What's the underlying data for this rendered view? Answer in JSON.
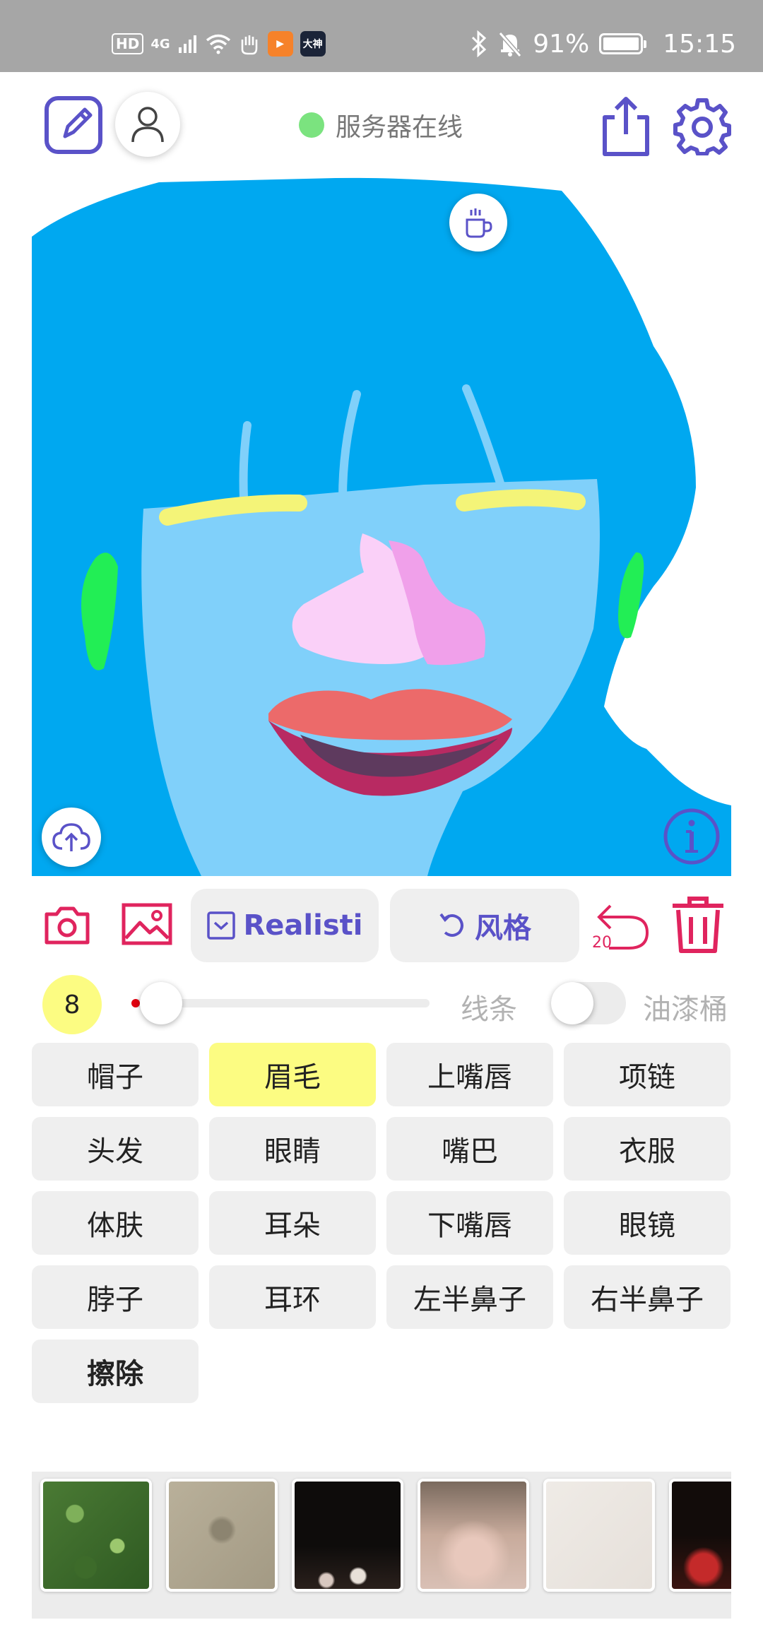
{
  "status_bar": {
    "network_label": "4G",
    "hd_label": "HD",
    "app_badge": "大神",
    "battery_percent": "91%",
    "time": "15:15"
  },
  "header": {
    "server_status": "服务器在线"
  },
  "toolbar": {
    "style_model_label": "Realisti",
    "style_button_label": "风格",
    "undo_count": "20"
  },
  "brush": {
    "size": "8",
    "line_mode_label": "线条",
    "bucket_mode_label": "油漆桶"
  },
  "parts": [
    {
      "label": "帽子",
      "selected": false
    },
    {
      "label": "眉毛",
      "selected": true
    },
    {
      "label": "上嘴唇",
      "selected": false
    },
    {
      "label": "项链",
      "selected": false
    },
    {
      "label": "头发",
      "selected": false
    },
    {
      "label": "眼睛",
      "selected": false
    },
    {
      "label": "嘴巴",
      "selected": false
    },
    {
      "label": "衣服",
      "selected": false
    },
    {
      "label": "体肤",
      "selected": false
    },
    {
      "label": "耳朵",
      "selected": false
    },
    {
      "label": "下嘴唇",
      "selected": false
    },
    {
      "label": "眼镜",
      "selected": false
    },
    {
      "label": "脖子",
      "selected": false
    },
    {
      "label": "耳环",
      "selected": false
    },
    {
      "label": "左半鼻子",
      "selected": false
    },
    {
      "label": "右半鼻子",
      "selected": false
    },
    {
      "label": "擦除",
      "selected": false
    }
  ],
  "colors": {
    "accent": "#5a52c8",
    "danger": "#e0245e",
    "selected_part": "#fcfc82",
    "server_online": "#7be37f",
    "hair": "#00a8f0",
    "skin": "#80d0fa",
    "eyebrow": "#f4f478",
    "ear": "#22ee55",
    "nose_left": "#fad0f8",
    "nose_right": "#f0a0ea",
    "upper_lip": "#ec6a6a",
    "mouth": "#5e3a5e",
    "lower_lip": "#b82a62"
  },
  "icons": {
    "edit": "edit-icon",
    "user": "user-icon",
    "share": "share-icon",
    "settings": "gear-icon",
    "coffee": "coffee-icon",
    "upload": "cloud-upload-icon",
    "info": "info-icon",
    "camera": "camera-icon",
    "gallery": "image-icon",
    "undo": "undo-icon",
    "delete": "trash-icon"
  }
}
